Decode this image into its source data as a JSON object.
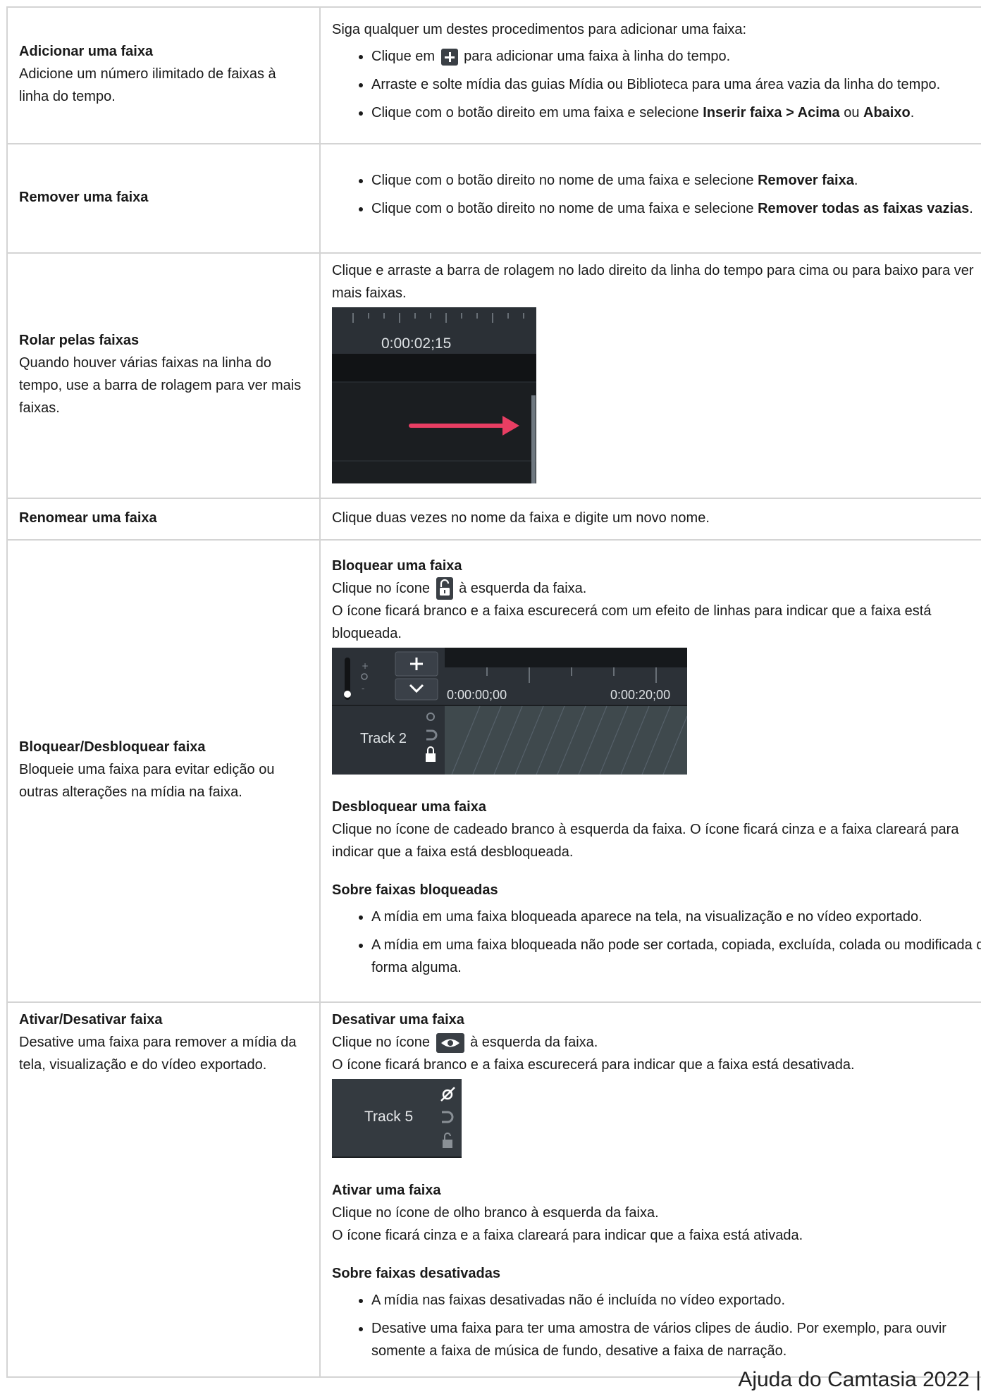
{
  "rows": [
    {
      "title": "Adicionar uma faixa",
      "desc": "Adicione um número ilimitado de faixas à linha do tempo.",
      "intro": "Siga qualquer um destes procedimentos para adicionar uma faixa:",
      "b1a": "Clique em",
      "b1b": "para adicionar uma faixa à linha do tempo.",
      "b2": "Arraste e solte mídia das guias Mídia ou Biblioteca para uma área vazia da linha do tempo.",
      "b3a": "Clique com o botão direito em uma faixa e selecione ",
      "b3b": "Inserir faixa",
      "b3c": " > ",
      "b3d": "Acima",
      "b3e": " ou ",
      "b3f": "Abaixo",
      "b3g": "."
    },
    {
      "title": "Remover uma faixa",
      "b1a": "Clique com o botão direito no nome de uma faixa e selecione ",
      "b1b": "Remover faixa",
      "b1c": ".",
      "b2a": "Clique com o botão direito no nome de uma faixa e selecione ",
      "b2b": "Remover todas as faixas vazias",
      "b2c": "."
    },
    {
      "title": "Rolar pelas faixas",
      "desc": "Quando houver várias faixas na linha do tempo, use a barra de rolagem para ver mais faixas.",
      "text": "Clique e arraste a barra de rolagem no lado direito da linha do tempo para cima ou para baixo para ver mais faixas.",
      "shot_time": "0:00:02;15"
    },
    {
      "title": "Renomear uma faixa",
      "text": "Clique duas vezes no nome da faixa e digite um novo nome."
    },
    {
      "title": "Bloquear/Desbloquear faixa",
      "desc": "Bloqueie uma faixa para evitar edição ou outras alterações na mídia na faixa.",
      "h1": "Bloquear uma faixa",
      "p1a": "Clique no ícone",
      "p1b": "à esquerda da faixa.",
      "p2": "O ícone ficará branco e a faixa escurecerá com um efeito de linhas para indicar que a faixa está bloqueada.",
      "shot_t1": "0:00:00;00",
      "shot_t2": "0:00:20;00",
      "shot_track": "Track 2",
      "h2": "Desbloquear uma faixa",
      "p3": "Clique no ícone de cadeado branco à esquerda da faixa. O ícone ficará cinza e a faixa clareará para indicar que a faixa está desbloqueada.",
      "h3": "Sobre faixas bloqueadas",
      "b1": "A mídia em uma faixa bloqueada aparece na tela, na visualização e no vídeo exportado.",
      "b2": "A mídia em uma faixa bloqueada não pode ser cortada, copiada, excluída, colada ou modificada de forma alguma."
    },
    {
      "title": "Ativar/Desativar faixa",
      "desc": "Desative uma faixa para remover a mídia da tela, visualização e do vídeo exportado.",
      "h1": "Desativar uma faixa",
      "p1a": "Clique no ícone",
      "p1b": "à esquerda da faixa.",
      "p2": "O ícone ficará branco e a faixa escurecerá para indicar que a faixa está desativada.",
      "shot_track": "Track 5",
      "h2": "Ativar uma faixa",
      "p3": "Clique no ícone de olho branco à esquerda da faixa.",
      "p4": "O ícone ficará cinza e a faixa clareará para indicar que a faixa está ativada.",
      "h3": "Sobre faixas desativadas",
      "b1": "A mídia nas faixas desativadas não é incluída no vídeo exportado.",
      "b2": "Desative uma faixa para ter uma amostra de vários clipes de áudio. Por exemplo, para ouvir somente a faixa de música de fundo, desative a faixa de narração."
    }
  ],
  "footer": "Ajuda do Camtasia 2022 |"
}
